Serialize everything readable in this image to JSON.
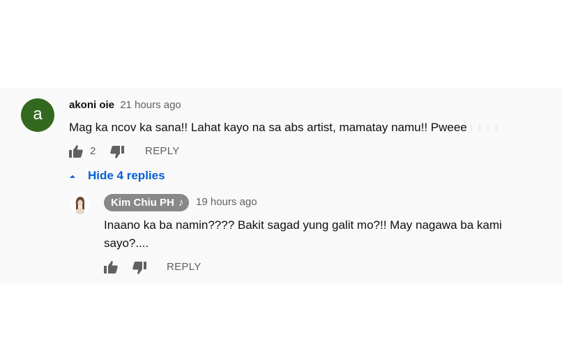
{
  "comment": {
    "avatar_letter": "a",
    "avatar_color": "#33691e",
    "author": "akoni oie",
    "time": "21 hours ago",
    "text": "Mag ka ncov ka sana!!  Lahat kayo na sa abs artist,  mamatay namu!!  Pweee",
    "text_trail": "l l l l",
    "like_count": "2",
    "reply_label": "REPLY",
    "toggle_label": "Hide 4 replies"
  },
  "reply": {
    "author": "Kim Chiu PH",
    "author_badge_icon": "music-note-icon",
    "time": "19 hours ago",
    "text": "Inaano ka ba namin???? Bakit sagad yung galit mo?!! May nagawa ba kami sayo?....",
    "reply_label": "REPLY"
  },
  "colors": {
    "link": "#065fd4",
    "secondary_text": "#606060",
    "badge_bg": "#888888",
    "panel_bg": "#f9f9f9"
  }
}
